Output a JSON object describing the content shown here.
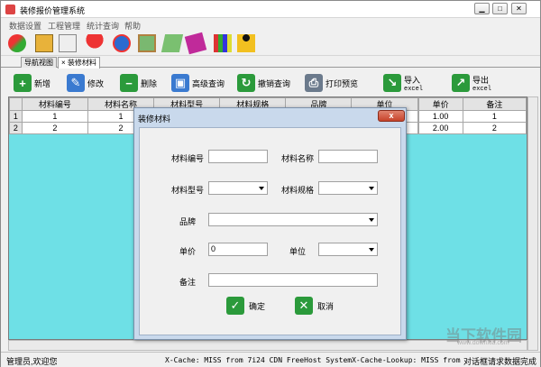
{
  "window": {
    "title": "装修报价管理系统"
  },
  "menu": [
    "数据设置",
    "工程管理",
    "统计查询",
    "帮助"
  ],
  "toolbar_icons": [
    "users-icon",
    "book-icon",
    "pen-icon",
    "umbrella-icon",
    "alarm-icon",
    "picture-icon",
    "notebook-icon",
    "books-icon",
    "bookshelf-icon",
    "runner-icon"
  ],
  "tabs": [
    {
      "label": "导航视图",
      "active": false
    },
    {
      "label": "× 装修材料",
      "active": true
    }
  ],
  "actions": [
    {
      "label": "新增",
      "sub": "",
      "icon": "plus-icon",
      "color": "#2b9a3b",
      "glyph": "+"
    },
    {
      "label": "修改",
      "sub": "",
      "icon": "edit-icon",
      "color": "#3a7ad0",
      "glyph": "✎"
    },
    {
      "label": "删除",
      "sub": "",
      "icon": "minus-icon",
      "color": "#2b9a3b",
      "glyph": "−"
    },
    {
      "label": "高级查询",
      "sub": "",
      "icon": "monitor-icon",
      "color": "#3a7ad0",
      "glyph": "▣"
    },
    {
      "label": "撤销查询",
      "sub": "",
      "icon": "refresh-icon",
      "color": "#2b9a3b",
      "glyph": "↻"
    },
    {
      "label": "打印预览",
      "sub": "",
      "icon": "printer-icon",
      "color": "#6b7a8c",
      "glyph": "⎙"
    },
    {
      "label": "导入",
      "sub": "excel",
      "icon": "import-icon",
      "color": "#2b9a3b",
      "glyph": "↘"
    },
    {
      "label": "导出",
      "sub": "excel",
      "icon": "export-icon",
      "color": "#2b9a3b",
      "glyph": "↗"
    }
  ],
  "table": {
    "columns": [
      "",
      "材料编号",
      "材料名称",
      "材料型号",
      "材料规格",
      "品牌",
      "单位",
      "",
      "单价",
      "备注"
    ],
    "rows": [
      [
        "1",
        "1",
        "1",
        "",
        "",
        "",
        "",
        "",
        "1.00",
        "1"
      ],
      [
        "2",
        "2",
        "2",
        "",
        "",
        "",
        "",
        "",
        "2.00",
        "2"
      ]
    ]
  },
  "dialog": {
    "title": "装修材料",
    "close": "x",
    "labels": {
      "code": "材料编号",
      "name": "材料名称",
      "model": "材料型号",
      "spec": "材料规格",
      "brand": "品牌",
      "price": "单价",
      "unit": "单位",
      "note": "备注"
    },
    "values": {
      "code": "",
      "name": "",
      "model": "",
      "spec": "",
      "brand": "",
      "price": "0",
      "unit": "",
      "note": ""
    },
    "ok": "确定",
    "cancel": "取消"
  },
  "status": {
    "user": "管理员,欢迎您",
    "message": "X-Cache: MISS from 7i24 CDN FreeHost SystemX-Cache-Lookup: MISS from",
    "right": "对话框请求数据完成"
  },
  "watermark": {
    "text": "当下软件园",
    "url": "www.downxia.com"
  },
  "colors": {
    "grid_bg": "#6ee0e6",
    "dialog_frame": "#c9d9ec",
    "close_red": "#c7432a",
    "green": "#2b9a3b"
  }
}
